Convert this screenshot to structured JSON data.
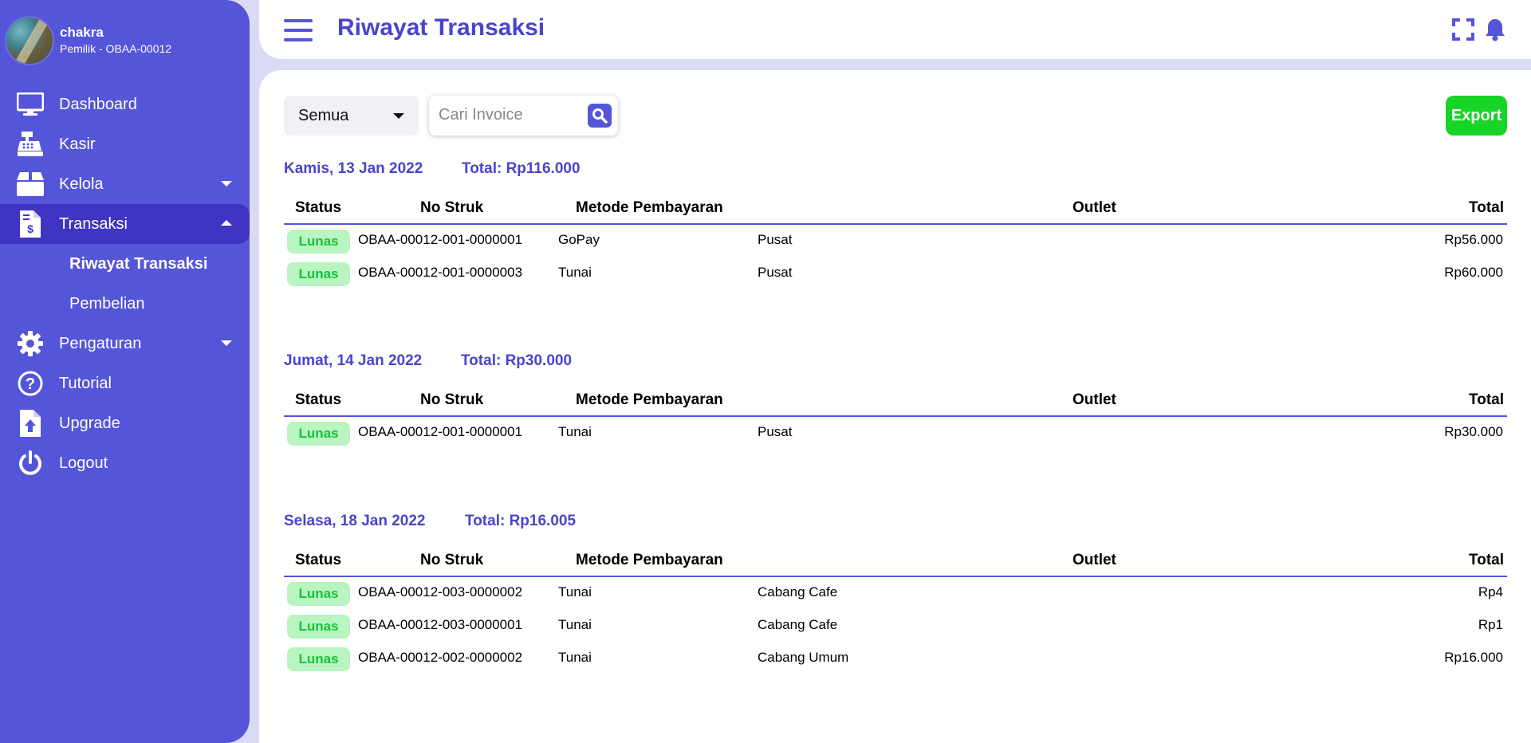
{
  "user": {
    "name": "chakra",
    "role": "Pemilik - OBAA-00012"
  },
  "sidebar": {
    "items": [
      {
        "label": "Dashboard"
      },
      {
        "label": "Kasir"
      },
      {
        "label": "Kelola"
      },
      {
        "label": "Transaksi"
      },
      {
        "label": "Pengaturan"
      },
      {
        "label": "Tutorial"
      },
      {
        "label": "Upgrade"
      },
      {
        "label": "Logout"
      }
    ],
    "submenu": [
      {
        "label": "Riwayat Transaksi"
      },
      {
        "label": "Pembelian"
      }
    ]
  },
  "header": {
    "title": "Riwayat Transaksi"
  },
  "filters": {
    "select_value": "Semua",
    "search_placeholder": "Cari Invoice",
    "export_label": "Export"
  },
  "table_headers": {
    "status": "Status",
    "no_struk": "No Struk",
    "metode": "Metode Pembayaran",
    "outlet": "Outlet",
    "total": "Total"
  },
  "groups": [
    {
      "date": "Kamis, 13 Jan 2022",
      "total": "Total: Rp116.000",
      "rows": [
        {
          "status": "Lunas",
          "no": "OBAA-00012-001-0000001",
          "metode": "GoPay",
          "outlet": "Pusat",
          "total": "Rp56.000"
        },
        {
          "status": "Lunas",
          "no": "OBAA-00012-001-0000003",
          "metode": "Tunai",
          "outlet": "Pusat",
          "total": "Rp60.000"
        }
      ]
    },
    {
      "date": "Jumat, 14 Jan 2022",
      "total": "Total: Rp30.000",
      "rows": [
        {
          "status": "Lunas",
          "no": "OBAA-00012-001-0000001",
          "metode": "Tunai",
          "outlet": "Pusat",
          "total": "Rp30.000"
        }
      ]
    },
    {
      "date": "Selasa, 18 Jan 2022",
      "total": "Total: Rp16.005",
      "rows": [
        {
          "status": "Lunas",
          "no": "OBAA-00012-003-0000002",
          "metode": "Tunai",
          "outlet": "Cabang Cafe",
          "total": "Rp4"
        },
        {
          "status": "Lunas",
          "no": "OBAA-00012-003-0000001",
          "metode": "Tunai",
          "outlet": "Cabang Cafe",
          "total": "Rp1"
        },
        {
          "status": "Lunas",
          "no": "OBAA-00012-002-0000002",
          "metode": "Tunai",
          "outlet": "Cabang Umum",
          "total": "Rp16.000"
        }
      ]
    }
  ],
  "colors": {
    "sidebar_bg": "#5455d9",
    "sidebar_active": "#4034c4",
    "accent_text": "#4a44cc",
    "badge_bg": "#b8f5c0",
    "badge_text": "#17c23a",
    "export_bg": "#17d427",
    "page_bg": "#d9daf5"
  },
  "icons": {
    "hamburger": "menu-icon",
    "fullscreen": "fullscreen-icon",
    "notification": "bell-icon",
    "search": "search-icon"
  }
}
